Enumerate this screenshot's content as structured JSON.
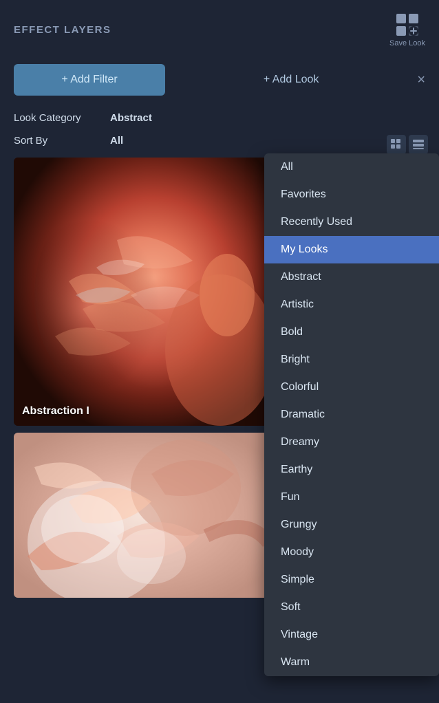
{
  "header": {
    "title": "EFFECT LAYERS",
    "save_look_label": "Save Look"
  },
  "toolbar": {
    "add_filter_label": "+ Add Filter",
    "add_look_label": "+ Add Look",
    "close_label": "×"
  },
  "filters": {
    "look_category_label": "Look Category",
    "look_category_value": "Abstract",
    "sort_by_label": "Sort By",
    "sort_by_value": "All"
  },
  "images": [
    {
      "name": "Abstraction I",
      "type": "flamingo"
    },
    {
      "name": "",
      "type": "abstract"
    }
  ],
  "dropdown": {
    "items": [
      {
        "label": "All",
        "selected": false
      },
      {
        "label": "Favorites",
        "selected": false
      },
      {
        "label": "Recently Used",
        "selected": false
      },
      {
        "label": "My Looks",
        "selected": true
      },
      {
        "label": "Abstract",
        "selected": false
      },
      {
        "label": "Artistic",
        "selected": false
      },
      {
        "label": "Bold",
        "selected": false
      },
      {
        "label": "Bright",
        "selected": false
      },
      {
        "label": "Colorful",
        "selected": false
      },
      {
        "label": "Dramatic",
        "selected": false
      },
      {
        "label": "Dreamy",
        "selected": false
      },
      {
        "label": "Earthy",
        "selected": false
      },
      {
        "label": "Fun",
        "selected": false
      },
      {
        "label": "Grungy",
        "selected": false
      },
      {
        "label": "Moody",
        "selected": false
      },
      {
        "label": "Simple",
        "selected": false
      },
      {
        "label": "Soft",
        "selected": false
      },
      {
        "label": "Vintage",
        "selected": false
      },
      {
        "label": "Warm",
        "selected": false
      }
    ]
  }
}
